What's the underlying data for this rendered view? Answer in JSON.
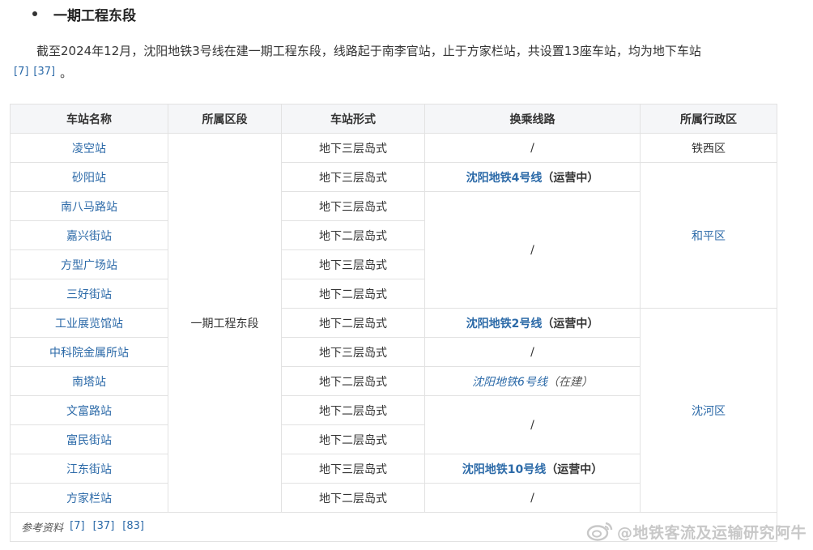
{
  "heading": "一期工程东段",
  "paragraph": "截至2024年12月，沈阳地铁3号线在建一期工程东段，线路起于南李官站，止于方家栏站，共设置13座车站，均为地下车站",
  "paragraph_end": "。",
  "paragraph_citations": [
    "[7]",
    "[37]"
  ],
  "table": {
    "headers": [
      "车站名称",
      "所属区段",
      "车站形式",
      "换乘线路",
      "所属行政区"
    ],
    "segment": "一期工程东段",
    "stations": [
      "凌空站",
      "砂阳站",
      "南八马路站",
      "嘉兴街站",
      "方型广场站",
      "三好街站",
      "工业展览馆站",
      "中科院金属所站",
      "南塔站",
      "文富路站",
      "富民街站",
      "江东街站",
      "方家栏站"
    ],
    "forms": [
      "地下三层岛式",
      "地下三层岛式",
      "地下三层岛式",
      "地下二层岛式",
      "地下三层岛式",
      "地下二层岛式",
      "地下二层岛式",
      "地下三层岛式",
      "地下二层岛式",
      "地下二层岛式",
      "地下二层岛式",
      "地下三层岛式",
      "地下二层岛式"
    ],
    "transfers": {
      "none": "/",
      "line4": "沈阳地铁4号线",
      "line4_status": "（运营中）",
      "line2": "沈阳地铁2号线",
      "line2_status": "（运营中）",
      "line6": "沈阳地铁6号线",
      "line6_status": "（在建）",
      "line10": "沈阳地铁10号线",
      "line10_status": "（运营中）"
    },
    "districts": [
      "铁西区",
      "和平区",
      "沈河区"
    ],
    "references_label": "参考资料",
    "references": [
      "[7]",
      "[37]",
      "[83]"
    ]
  },
  "watermark": "@地铁客流及运输研究阿牛",
  "watermark_icon": "weibo-icon"
}
